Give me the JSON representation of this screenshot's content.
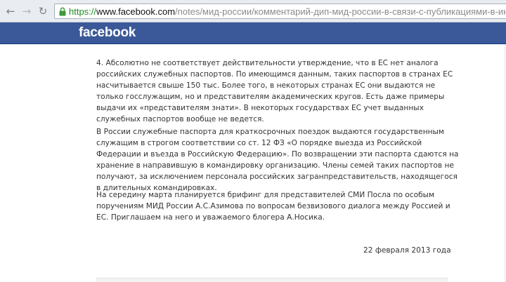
{
  "browser": {
    "url_scheme": "https://",
    "url_host": "www.facebook.com",
    "url_path": "/notes/мид-россии/комментарий-дип-мид-россии-в-связи-с-публикациями-в-интернете-п",
    "back_icon": "back-arrow-icon",
    "forward_icon": "forward-arrow-icon",
    "reload_icon": "reload-icon",
    "lock_icon": "lock-icon",
    "secure_color": "#1e8a1e"
  },
  "header": {
    "logo": "facebook",
    "brand_color": "#3b5998"
  },
  "note": {
    "paragraph_1": "4. Абсолютно не соответствует действительности утверждение, что в ЕС нет аналога российских служебных паспортов. По имеющимся данным, таких паспортов в странах ЕС насчитывается свыше 150 тыс. Более того, в некоторых странах ЕС они выдаются не только госслужащим, но и представителям академических кругов. Есть даже примеры выдачи их «представителям знати». В некоторых государствах ЕС учет выданных служебных паспортов вообще не ведется.",
    "paragraph_2": "В России служебные паспорта для краткосрочных поездок выдаются государственным служащим в строгом соответствии со ст. 12 ФЗ «О порядке выезда из Российской Федерации и въезда в Российскую Федерацию». По возвращении эти паспорта сдаются на хранение в направившую в командировку организацию. Члены семей таких паспортов не получают, за исключением персонала российских загранпредставительств, находящегося в длительных командировках.",
    "paragraph_3": "На середину марта планируется брифинг для представителей СМИ Посла по особым поручениям МИД России А.С.Азимова по вопросам безвизового диалога между Россией и ЕС. Приглашаем на него и уважаемого блогера А.Носика.",
    "date": "22 февраля 2013 года"
  }
}
